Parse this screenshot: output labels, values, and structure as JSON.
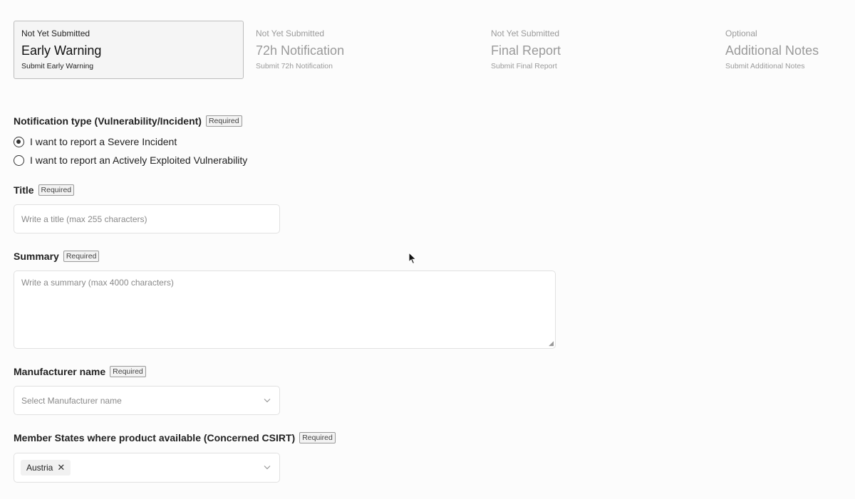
{
  "steps": [
    {
      "status": "Not Yet Submitted",
      "name": "Early Warning",
      "sub": "Submit Early Warning"
    },
    {
      "status": "Not Yet Submitted",
      "name": "72h Notification",
      "sub": "Submit 72h Notification"
    },
    {
      "status": "Not Yet Submitted",
      "name": "Final Report",
      "sub": "Submit Final Report"
    },
    {
      "status": "Optional",
      "name": "Additional Notes",
      "sub": "Submit Additional Notes"
    }
  ],
  "required_label": "Required",
  "notification_type": {
    "label": "Notification type (Vulnerability/Incident)",
    "options": [
      "I want to report a Severe Incident",
      "I want to report an Actively Exploited Vulnerability"
    ],
    "selected_index": 0
  },
  "title_field": {
    "label": "Title",
    "placeholder": "Write a title (max 255 characters)"
  },
  "summary_field": {
    "label": "Summary",
    "placeholder": "Write a summary (max 4000 characters)"
  },
  "manufacturer_field": {
    "label": "Manufacturer name",
    "placeholder": "Select Manufacturer name"
  },
  "member_states_field": {
    "label": "Member States where product available (Concerned CSIRT)",
    "selected_tags": [
      "Austria"
    ]
  },
  "icons": {
    "chevron": "chevron-down-icon",
    "remove": "close-icon",
    "cursor": "mouse-pointer-icon"
  }
}
